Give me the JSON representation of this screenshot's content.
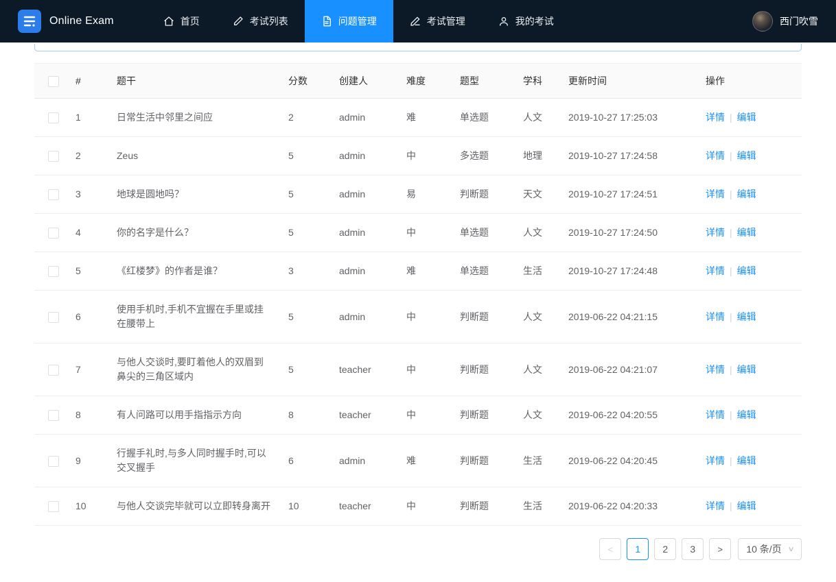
{
  "colors": {
    "accent": "#1890ff",
    "navbar_bg": "#0c1a28",
    "link": "#1890ff",
    "table_header_bg": "#fafafa"
  },
  "navbar": {
    "brand": "Online Exam",
    "items": [
      {
        "id": "home",
        "label": "首页",
        "icon": "home-icon",
        "active": false
      },
      {
        "id": "exam-list",
        "label": "考试列表",
        "icon": "pen-icon",
        "active": false
      },
      {
        "id": "question-management",
        "label": "问题管理",
        "icon": "document-icon",
        "active": true
      },
      {
        "id": "exam-management",
        "label": "考试管理",
        "icon": "edit-icon",
        "active": false
      },
      {
        "id": "my-exams",
        "label": "我的考试",
        "icon": "user-icon",
        "active": false
      }
    ],
    "user": "西门吹雪"
  },
  "table": {
    "columns": [
      "#",
      "题干",
      "分数",
      "创建人",
      "难度",
      "题型",
      "学科",
      "更新时间",
      "操作"
    ],
    "actions": {
      "detail": "详情",
      "divider": "|",
      "edit": "编辑"
    },
    "rows": [
      {
        "index": "1",
        "title": "日常生活中邻里之间应",
        "score": "2",
        "creator": "admin",
        "difficulty": "难",
        "type": "单选题",
        "subject": "人文",
        "updated": "2019-10-27 17:25:03"
      },
      {
        "index": "2",
        "title": "Zeus",
        "score": "5",
        "creator": "admin",
        "difficulty": "中",
        "type": "多选题",
        "subject": "地理",
        "updated": "2019-10-27 17:24:58"
      },
      {
        "index": "3",
        "title": "地球是圆地吗？",
        "score": "5",
        "creator": "admin",
        "difficulty": "易",
        "type": "判断题",
        "subject": "天文",
        "updated": "2019-10-27 17:24:51"
      },
      {
        "index": "4",
        "title": "你的名字是什么？",
        "score": "5",
        "creator": "admin",
        "difficulty": "中",
        "type": "单选题",
        "subject": "人文",
        "updated": "2019-10-27 17:24:50"
      },
      {
        "index": "5",
        "title": "《红楼梦》的作者是谁？",
        "score": "3",
        "creator": "admin",
        "difficulty": "难",
        "type": "单选题",
        "subject": "生活",
        "updated": "2019-10-27 17:24:48"
      },
      {
        "index": "6",
        "title": "使用手机时,手机不宜握在手里或挂在腰带上",
        "score": "5",
        "creator": "admin",
        "difficulty": "中",
        "type": "判断题",
        "subject": "人文",
        "updated": "2019-06-22 04:21:15"
      },
      {
        "index": "7",
        "title": "与他人交谈时,要盯着他人的双眉到鼻尖的三角区域内",
        "score": "5",
        "creator": "teacher",
        "difficulty": "中",
        "type": "判断题",
        "subject": "人文",
        "updated": "2019-06-22 04:21:07"
      },
      {
        "index": "8",
        "title": "有人问路可以用手指指示方向",
        "score": "8",
        "creator": "teacher",
        "difficulty": "中",
        "type": "判断题",
        "subject": "人文",
        "updated": "2019-06-22 04:20:55"
      },
      {
        "index": "9",
        "title": "行握手礼时,与多人同时握手时,可以交叉握手",
        "score": "6",
        "creator": "admin",
        "difficulty": "难",
        "type": "判断题",
        "subject": "生活",
        "updated": "2019-06-22 04:20:45"
      },
      {
        "index": "10",
        "title": "与他人交谈完毕就可以立即转身离开",
        "score": "10",
        "creator": "teacher",
        "difficulty": "中",
        "type": "判断题",
        "subject": "生活",
        "updated": "2019-06-22 04:20:33"
      }
    ]
  },
  "pagination": {
    "prev_icon": "<",
    "next_icon": ">",
    "pages": [
      "1",
      "2",
      "3"
    ],
    "current": "1",
    "page_size": "10 条/页",
    "chevron": "∨"
  }
}
